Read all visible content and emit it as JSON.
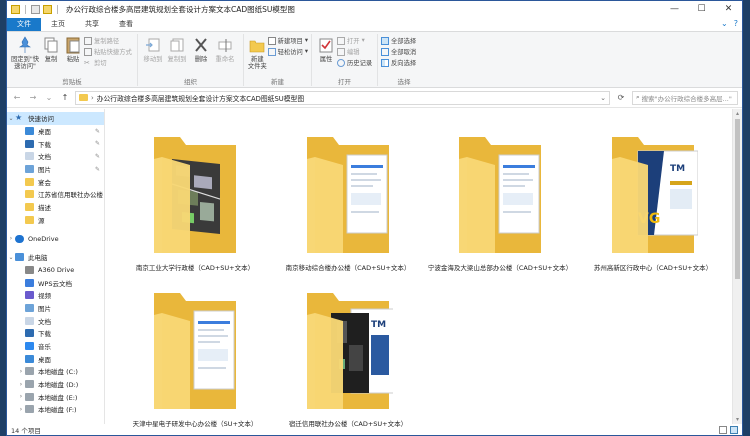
{
  "window": {
    "title": "办公行政综合楼多高层建筑规划全套设计方案文本CAD图纸SU模型图",
    "minimize": "—",
    "maximize": "☐",
    "close": "✕"
  },
  "ribbon_tabs": [
    "文件",
    "主页",
    "共享",
    "查看"
  ],
  "ribbon": {
    "clipboard": {
      "pin_quick": "固定到\"快\n速访问\"",
      "copy": "复制",
      "paste": "粘贴",
      "copy_path": "复制路径",
      "paste_shortcut": "粘贴快捷方式",
      "cut": "剪切",
      "label": "剪贴板"
    },
    "organize": {
      "move_to": "移动到",
      "copy_to": "复制到",
      "delete": "删除",
      "rename": "重命名",
      "label": "组织"
    },
    "new": {
      "new_folder": "新建\n文件夹",
      "new_item": "新建项目",
      "easy_access": "轻松访问",
      "label": "新建"
    },
    "open": {
      "properties": "属性",
      "open": "打开",
      "edit": "编辑",
      "history": "历史记录",
      "label": "打开"
    },
    "select": {
      "select_all": "全部选择",
      "select_none": "全部取消",
      "invert": "反向选择",
      "label": "选择"
    }
  },
  "address": {
    "path": "办公行政综合楼多高层建筑规划全套设计方案文本CAD图纸SU模型图",
    "search_placeholder": "搜索\"办公行政综合楼多高层...\""
  },
  "nav": [
    {
      "label": "快速访问",
      "type": "header",
      "pinned": false
    },
    {
      "label": "桌面",
      "type": "desktop",
      "pinned": true
    },
    {
      "label": "下载",
      "type": "download",
      "pinned": true
    },
    {
      "label": "文档",
      "type": "doc",
      "pinned": true
    },
    {
      "label": "图片",
      "type": "pic",
      "pinned": true
    },
    {
      "label": "宴会",
      "type": "folder",
      "pinned": false
    },
    {
      "label": "江苏省信用联社办公楼（",
      "type": "folder",
      "pinned": false
    },
    {
      "label": "描述",
      "type": "folder",
      "pinned": false
    },
    {
      "label": "源",
      "type": "folder",
      "pinned": false
    },
    {
      "label": "",
      "type": "spacer",
      "pinned": false
    },
    {
      "label": "OneDrive",
      "type": "cloud",
      "pinned": false
    },
    {
      "label": "",
      "type": "spacer",
      "pinned": false
    },
    {
      "label": "此电脑",
      "type": "pc",
      "pinned": false
    },
    {
      "label": "A360 Drive",
      "type": "a360",
      "pinned": false
    },
    {
      "label": "WPS云文档",
      "type": "wps",
      "pinned": false
    },
    {
      "label": "视频",
      "type": "video",
      "pinned": false
    },
    {
      "label": "图片",
      "type": "pic",
      "pinned": false
    },
    {
      "label": "文档",
      "type": "doc",
      "pinned": false
    },
    {
      "label": "下载",
      "type": "download",
      "pinned": false
    },
    {
      "label": "音乐",
      "type": "music",
      "pinned": false
    },
    {
      "label": "桌面",
      "type": "desktop",
      "pinned": false
    },
    {
      "label": "本地磁盘 (C:)",
      "type": "drive",
      "pinned": false
    },
    {
      "label": "本地磁盘 (D:)",
      "type": "drive",
      "pinned": false
    },
    {
      "label": "本地磁盘 (E:)",
      "type": "drive",
      "pinned": false
    },
    {
      "label": "本地磁盘 (F:)",
      "type": "drive",
      "pinned": false
    }
  ],
  "files": [
    {
      "name": "南京工业大学行政楼（CAD+SU+文本）",
      "thumb": "aerial"
    },
    {
      "name": "南京移动综合楼办公楼（CAD+SU+文本）",
      "thumb": "doc"
    },
    {
      "name": "宁波金海及大梁山总部办公楼（CAD+SU+文本）",
      "thumb": "doc"
    },
    {
      "name": "苏州高新区行政中心（CAD+SU+文本）",
      "thumb": "brochure"
    },
    {
      "name": "天津中星电子研发中心办公楼（SU+文本）",
      "thumb": "doc"
    },
    {
      "name": "宿迁信用联社办公楼（CAD+SU+文本）",
      "thumb": "dark"
    }
  ],
  "status": {
    "count": "14 个项目"
  },
  "colors": {
    "accent": "#1979ca",
    "folder_back": "#e9b73b",
    "folder_front": "#f8d775",
    "selection": "#cce8ff"
  }
}
